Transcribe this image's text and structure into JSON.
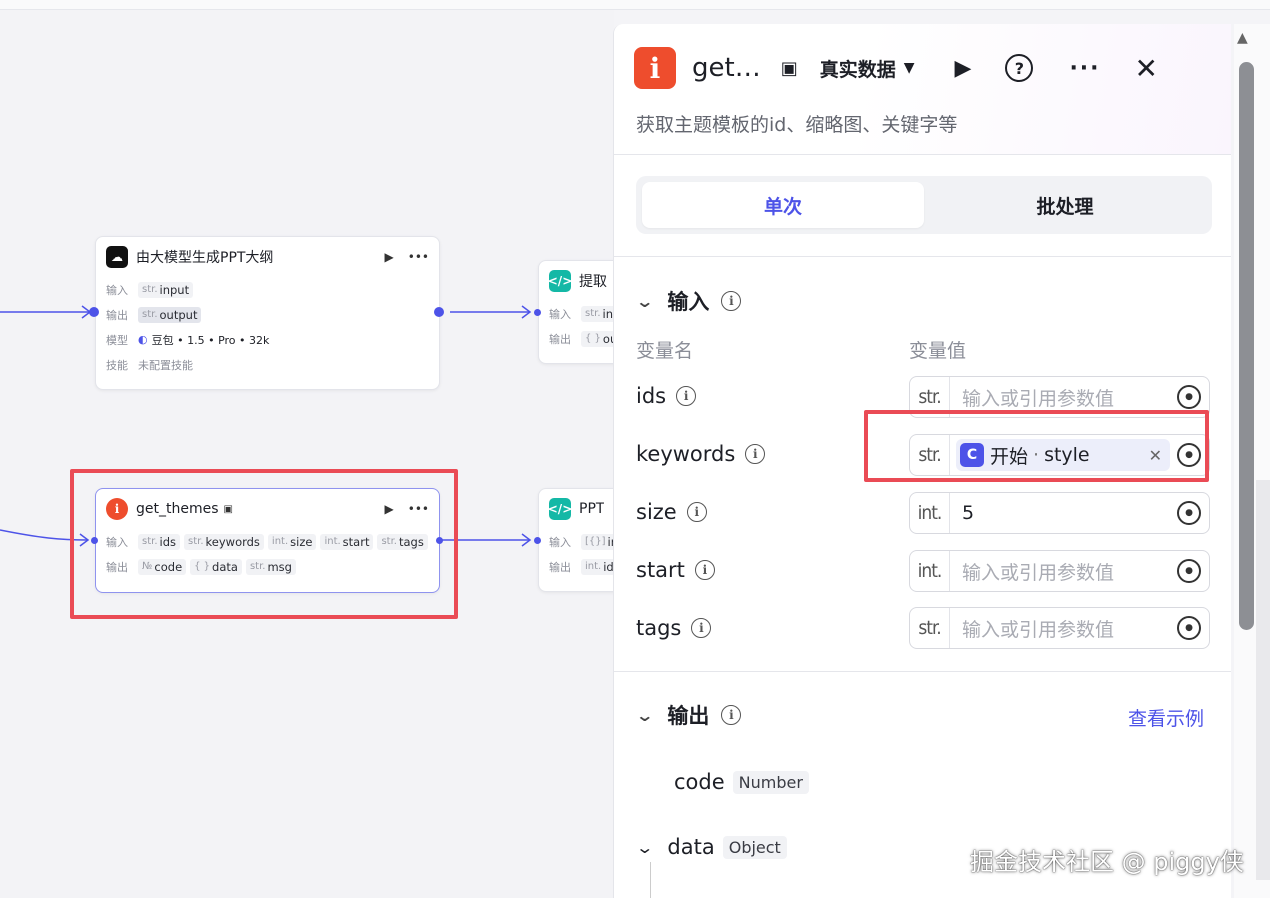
{
  "canvas": {
    "node1": {
      "title": "由大模型生成PPT大纲",
      "rows": [
        {
          "label": "输入",
          "tags": [
            {
              "t": "str.",
              "v": "input",
              "hl": false
            }
          ]
        },
        {
          "label": "输出",
          "tags": [
            {
              "t": "str.",
              "v": "output",
              "hl": true
            }
          ]
        },
        {
          "label": "模型",
          "text": "豆包 • 1.5 • Pro • 32k"
        },
        {
          "label": "技能",
          "text": "未配置技能"
        }
      ]
    },
    "node2": {
      "title": "提取",
      "rows": [
        {
          "label": "输入",
          "tags": [
            {
              "t": "str.",
              "v": "inp"
            }
          ]
        },
        {
          "label": "输出",
          "tags": [
            {
              "t": "{ }",
              "v": "ou"
            }
          ]
        }
      ]
    },
    "node3": {
      "title": "get_themes",
      "rows": [
        {
          "label": "输入",
          "tags": [
            {
              "t": "str.",
              "v": "ids"
            },
            {
              "t": "str.",
              "v": "keywords"
            },
            {
              "t": "int.",
              "v": "size"
            },
            {
              "t": "int.",
              "v": "start"
            },
            {
              "t": "str.",
              "v": "tags"
            }
          ]
        },
        {
          "label": "输出",
          "tags": [
            {
              "t": "№",
              "v": "code"
            },
            {
              "t": "{ }",
              "v": "data"
            },
            {
              "t": "str.",
              "v": "msg"
            }
          ]
        }
      ]
    },
    "node4": {
      "title": "PPT",
      "rows": [
        {
          "label": "输入",
          "tags": [
            {
              "t": "[{}]",
              "v": "in"
            }
          ]
        },
        {
          "label": "输出",
          "tags": [
            {
              "t": "int.",
              "v": "id"
            }
          ]
        }
      ]
    }
  },
  "panel": {
    "title": "get…",
    "mode": "真实数据",
    "description": "获取主题模板的id、缩略图、关键字等",
    "tabs": [
      "单次",
      "批处理"
    ],
    "active_tab": 0,
    "input_section": "输入",
    "col_name": "变量名",
    "col_value": "变量值",
    "params": [
      {
        "name": "ids",
        "type": "str.",
        "value": "",
        "placeholder": "输入或引用参数值"
      },
      {
        "name": "keywords",
        "type": "str.",
        "ref_node": "开始",
        "ref_var": "style"
      },
      {
        "name": "size",
        "type": "int.",
        "value": "5",
        "placeholder": ""
      },
      {
        "name": "start",
        "type": "int.",
        "value": "",
        "placeholder": "输入或引用参数值"
      },
      {
        "name": "tags",
        "type": "str.",
        "value": "",
        "placeholder": "输入或引用参数值"
      }
    ],
    "output_section": "输出",
    "view_example": "查看示例",
    "outputs": [
      {
        "name": "code",
        "type": "Number"
      },
      {
        "name": "data",
        "type": "Object"
      }
    ]
  },
  "watermark": "掘金技术社区 @ piggy侠",
  "colors": {
    "accent": "#4d53e8",
    "highlight": "#ea4b55",
    "plugin": "#ee4d2d",
    "code": "#14b8a6"
  }
}
